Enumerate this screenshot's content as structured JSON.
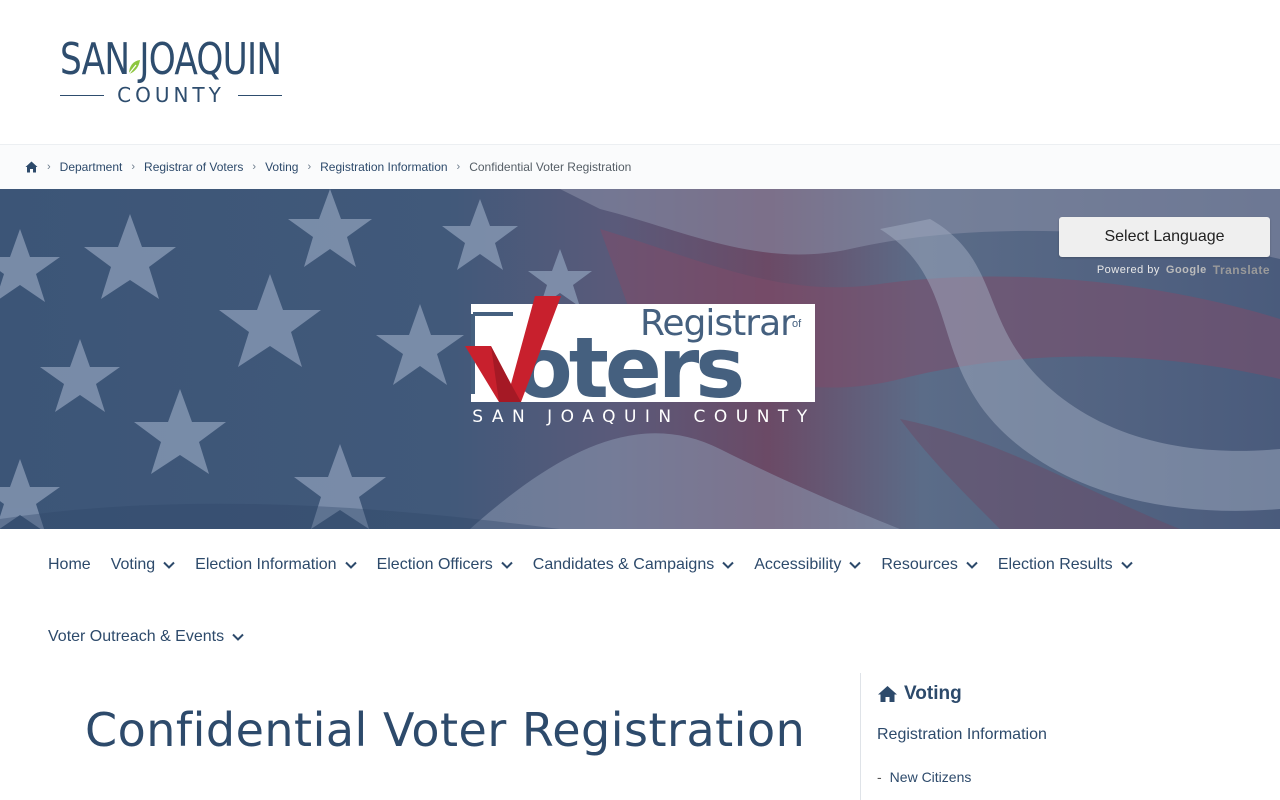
{
  "header": {
    "logo_top": "SAN JOAQUIN",
    "logo_bottom": "COUNTY"
  },
  "breadcrumb": {
    "home_icon": "home-icon",
    "items": [
      "Department",
      "Registrar of Voters",
      "Voting",
      "Registration Information"
    ],
    "current": "Confidential Voter Registration"
  },
  "hero": {
    "language_button": "Select Language",
    "powered_by": "Powered by",
    "google": "Google",
    "translate": "Translate",
    "logo": {
      "registrar": "Registrar",
      "of": "of",
      "voters": "oters",
      "county": "SAN JOAQUIN COUNTY"
    }
  },
  "nav": {
    "row1": [
      {
        "label": "Home",
        "dropdown": false
      },
      {
        "label": "Voting",
        "dropdown": true
      },
      {
        "label": "Election Information",
        "dropdown": true
      },
      {
        "label": "Election Officers",
        "dropdown": true
      },
      {
        "label": "Candidates & Campaigns",
        "dropdown": true
      },
      {
        "label": "Accessibility",
        "dropdown": true
      },
      {
        "label": "Resources",
        "dropdown": true
      },
      {
        "label": "Election Results",
        "dropdown": true
      }
    ],
    "row2": [
      {
        "label": "Voter Outreach & Events",
        "dropdown": true
      }
    ]
  },
  "main": {
    "title": "Confidential Voter Registration"
  },
  "sidebar": {
    "heading": "Voting",
    "item": "Registration Information",
    "subitem": "New Citizens",
    "subitem_marker": "-"
  },
  "colors": {
    "primary": "#2d4a6b",
    "accent_red": "#c8202d",
    "leaf_green": "#8dc63f"
  }
}
